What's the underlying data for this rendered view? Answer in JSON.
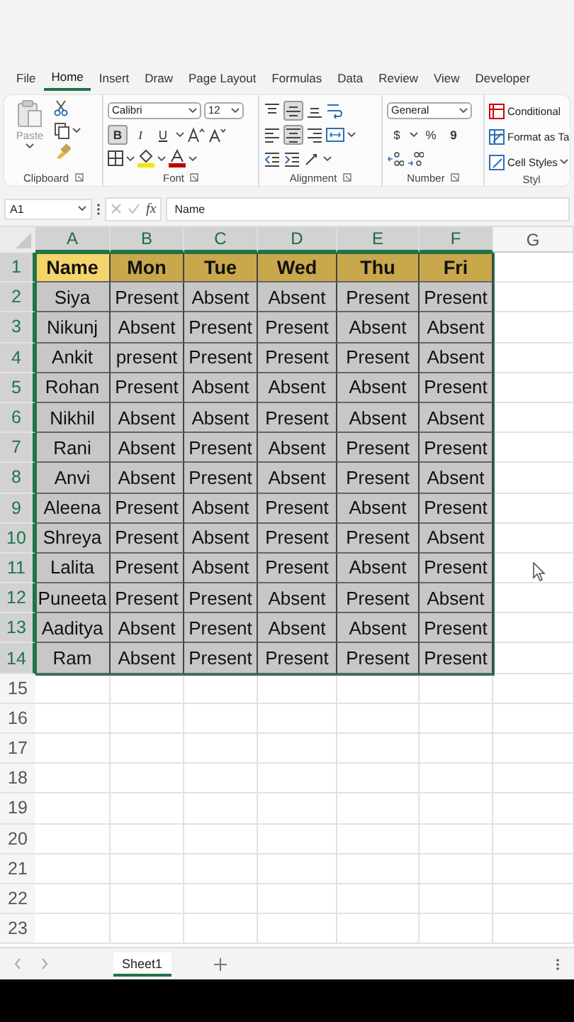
{
  "menu_tabs": [
    {
      "label": "File",
      "selected": false
    },
    {
      "label": "Home",
      "selected": true
    },
    {
      "label": "Insert",
      "selected": false
    },
    {
      "label": "Draw",
      "selected": false
    },
    {
      "label": "Page Layout",
      "selected": false
    },
    {
      "label": "Formulas",
      "selected": false
    },
    {
      "label": "Data",
      "selected": false
    },
    {
      "label": "Review",
      "selected": false
    },
    {
      "label": "View",
      "selected": false
    },
    {
      "label": "Developer",
      "selected": false
    }
  ],
  "ribbon": {
    "clipboard": {
      "paste": "Paste",
      "label": "Clipboard"
    },
    "font": {
      "name": "Calibri",
      "size": "12",
      "bold": {
        "glyph": "B",
        "on": true
      },
      "italic": {
        "glyph": "I",
        "on": false
      },
      "underline": {
        "glyph": "U",
        "on": false
      },
      "label": "Font"
    },
    "alignment": {
      "middle_on": true,
      "center_on": true,
      "label": "Alignment"
    },
    "number": {
      "format": "General",
      "currency": "$",
      "percent": "%",
      "comma": "9",
      "label": "Number"
    },
    "styles": {
      "items": [
        "Conditional",
        "Format as Ta",
        "Cell Styles"
      ],
      "label": "Styl"
    }
  },
  "formula_bar": {
    "name_box": "A1",
    "fx": "fx",
    "formula": "Name"
  },
  "sheet": {
    "columns": [
      {
        "label": "A",
        "selected": true
      },
      {
        "label": "B",
        "selected": true
      },
      {
        "label": "C",
        "selected": true
      },
      {
        "label": "D",
        "selected": true
      },
      {
        "label": "E",
        "selected": true
      },
      {
        "label": "F",
        "selected": true
      },
      {
        "label": "G",
        "selected": false
      }
    ],
    "rows": [
      {
        "number": "1",
        "selected": true,
        "kind": "header",
        "cells": [
          {
            "text": "Name",
            "selected": true
          },
          {
            "text": "Mon",
            "selected": false
          },
          {
            "text": "Tue",
            "selected": false
          },
          {
            "text": "Wed",
            "selected": false
          },
          {
            "text": "Thu",
            "selected": false
          },
          {
            "text": "Fri",
            "selected": false
          }
        ]
      },
      {
        "number": "2",
        "selected": true,
        "kind": "data",
        "cells": [
          "Siya",
          "Present",
          "Absent",
          "Absent",
          "Present",
          "Present"
        ]
      },
      {
        "number": "3",
        "selected": true,
        "kind": "data",
        "cells": [
          "Nikunj",
          "Absent",
          "Present",
          "Present",
          "Absent",
          "Absent"
        ]
      },
      {
        "number": "4",
        "selected": true,
        "kind": "data",
        "cells": [
          "Ankit",
          "present",
          "Present",
          "Present",
          "Present",
          "Absent"
        ]
      },
      {
        "number": "5",
        "selected": true,
        "kind": "data",
        "cells": [
          "Rohan",
          "Present",
          "Absent",
          "Absent",
          "Absent",
          "Present"
        ]
      },
      {
        "number": "6",
        "selected": true,
        "kind": "data",
        "cells": [
          "Nikhil",
          "Absent",
          "Absent",
          "Present",
          "Absent",
          "Absent"
        ]
      },
      {
        "number": "7",
        "selected": true,
        "kind": "data",
        "cells": [
          "Rani",
          "Absent",
          "Present",
          "Absent",
          "Present",
          "Present"
        ]
      },
      {
        "number": "8",
        "selected": true,
        "kind": "data",
        "cells": [
          "Anvi",
          "Absent",
          "Present",
          "Absent",
          "Present",
          "Absent"
        ]
      },
      {
        "number": "9",
        "selected": true,
        "kind": "data",
        "cells": [
          "Aleena",
          "Present",
          "Absent",
          "Present",
          "Absent",
          "Present"
        ]
      },
      {
        "number": "10",
        "selected": true,
        "kind": "data",
        "cells": [
          "Shreya",
          "Present",
          "Absent",
          "Present",
          "Present",
          "Absent"
        ]
      },
      {
        "number": "11",
        "selected": true,
        "kind": "data",
        "cells": [
          "Lalita",
          "Present",
          "Absent",
          "Present",
          "Absent",
          "Present"
        ]
      },
      {
        "number": "12",
        "selected": true,
        "kind": "data",
        "cells": [
          "Puneeta",
          "Present",
          "Present",
          "Absent",
          "Present",
          "Absent"
        ]
      },
      {
        "number": "13",
        "selected": true,
        "kind": "data",
        "cells": [
          "Aaditya",
          "Absent",
          "Present",
          "Absent",
          "Absent",
          "Present"
        ]
      },
      {
        "number": "14",
        "selected": true,
        "kind": "data",
        "cells": [
          "Ram",
          "Absent",
          "Present",
          "Present",
          "Present",
          "Present"
        ]
      },
      {
        "number": "15",
        "selected": false,
        "kind": "empty"
      },
      {
        "number": "16",
        "selected": false,
        "kind": "empty"
      },
      {
        "number": "17",
        "selected": false,
        "kind": "empty"
      },
      {
        "number": "18",
        "selected": false,
        "kind": "empty"
      },
      {
        "number": "19",
        "selected": false,
        "kind": "empty"
      },
      {
        "number": "20",
        "selected": false,
        "kind": "empty"
      },
      {
        "number": "21",
        "selected": false,
        "kind": "empty"
      },
      {
        "number": "22",
        "selected": false,
        "kind": "empty"
      },
      {
        "number": "23",
        "selected": false,
        "kind": "empty"
      }
    ]
  },
  "sheet_tabs": [
    {
      "label": "Sheet1",
      "selected": true
    }
  ]
}
